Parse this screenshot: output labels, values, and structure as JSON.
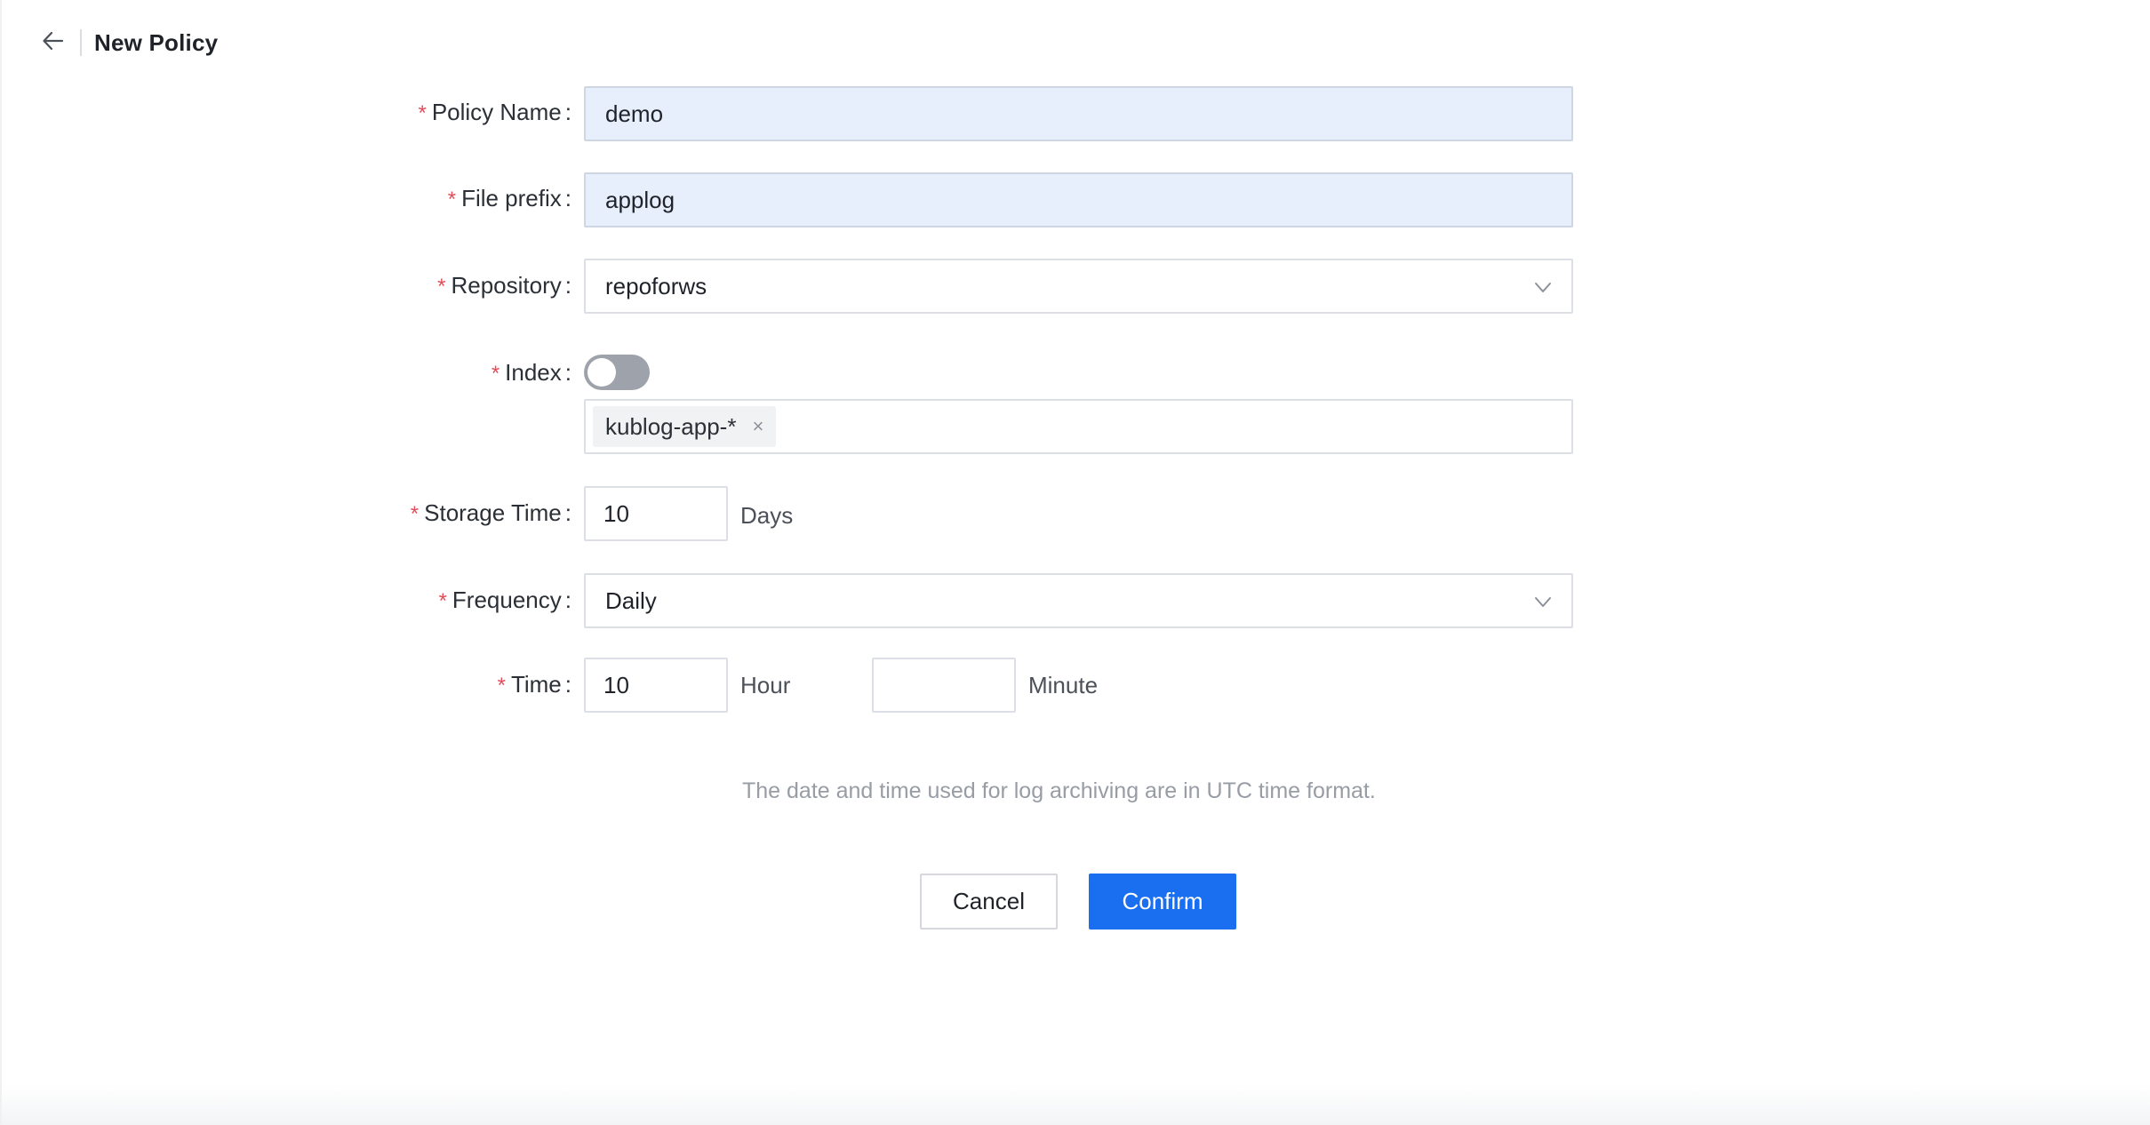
{
  "header": {
    "title": "New Policy",
    "back_icon": "arrow-left-icon"
  },
  "form": {
    "policy_name": {
      "label": "Policy Name",
      "value": "demo",
      "required": true
    },
    "file_prefix": {
      "label": "File prefix",
      "value": "applog",
      "required": true
    },
    "repository": {
      "label": "Repository",
      "value": "repoforws",
      "required": true
    },
    "index": {
      "label": "Index",
      "required": true,
      "toggle_on": false,
      "tags": [
        "kublog-app-*"
      ],
      "tag_close_glyph": "×"
    },
    "storage_time": {
      "label": "Storage Time",
      "value": "10",
      "unit": "Days",
      "required": true
    },
    "frequency": {
      "label": "Frequency",
      "value": "Daily",
      "required": true
    },
    "time": {
      "label": "Time",
      "required": true,
      "hour_value": "10",
      "hour_unit": "Hour",
      "minute_value": "",
      "minute_unit": "Minute"
    },
    "required_mark": "*",
    "colon": ":"
  },
  "hint": "The date and time used for log archiving are in UTC time format.",
  "actions": {
    "cancel_label": "Cancel",
    "confirm_label": "Confirm"
  },
  "colors": {
    "primary": "#1a6ef0",
    "required": "#e34d59",
    "filled_input_bg": "#e8effc",
    "toggle_off": "#9ea3ab"
  }
}
